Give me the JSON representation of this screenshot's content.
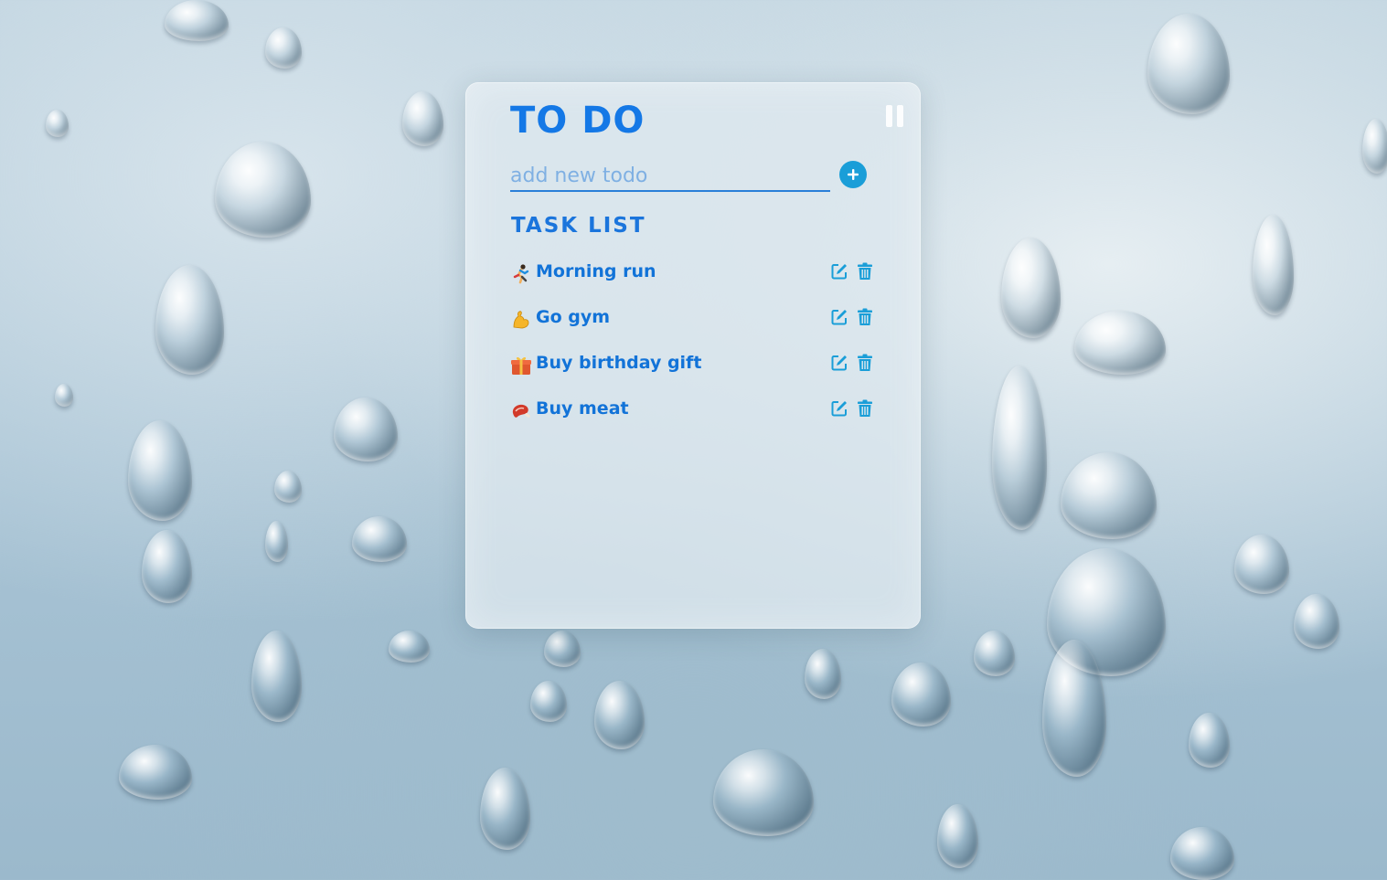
{
  "app": {
    "title": "TO DO",
    "pause_icon": "pause-icon"
  },
  "add_todo": {
    "placeholder": "add new todo",
    "value": "",
    "button_icon": "plus-circle-icon"
  },
  "task_list": {
    "heading": "TASK LIST",
    "items": [
      {
        "emoji_icon": "running-person-icon",
        "label": "Morning run"
      },
      {
        "emoji_icon": "flexed-biceps-icon",
        "label": "Go gym"
      },
      {
        "emoji_icon": "gift-icon",
        "label": "Buy birthday gift"
      },
      {
        "emoji_icon": "meat-icon",
        "label": "Buy meat"
      }
    ],
    "edit_icon": "edit-icon",
    "delete_icon": "trash-icon"
  },
  "colors": {
    "title": "#1478e6",
    "task_text": "#1273d8",
    "icons": "#1a9ed8",
    "add_button": "#1a9ed8"
  }
}
